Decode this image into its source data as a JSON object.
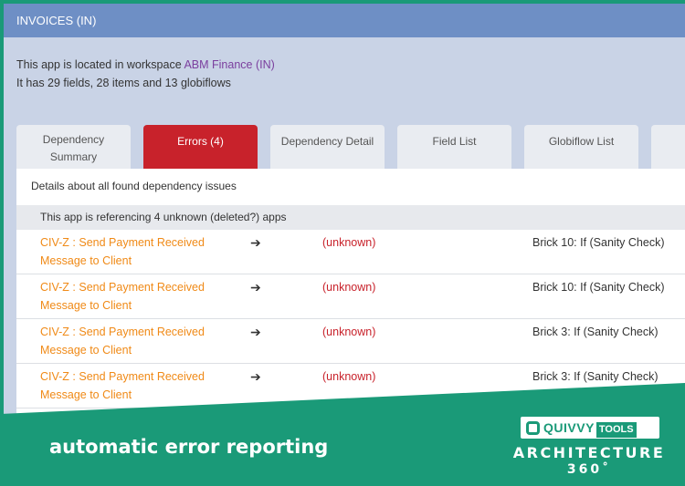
{
  "window": {
    "title": "INVOICES (IN)"
  },
  "info": {
    "location_prefix": "This app is located in workspace ",
    "workspace": "ABM Finance (IN)",
    "summary": "It has 29 fields, 28 items and 13 globiflows"
  },
  "tabs": [
    {
      "label": "Dependency\nSummary"
    },
    {
      "label": "Errors (4)"
    },
    {
      "label": "Dependency Detail"
    },
    {
      "label": "Field List"
    },
    {
      "label": "Globiflow List"
    }
  ],
  "content": {
    "description": "Details about all found dependency issues",
    "group_header": "This app is referencing 4 unknown (deleted?) apps",
    "rows": [
      {
        "source": "CIV-Z : Send Payment Received Message to Client",
        "arrow": "➔",
        "target": "(unknown)",
        "brick": "Brick 10: If (Sanity Check)"
      },
      {
        "source": "CIV-Z : Send Payment Received Message to Client",
        "arrow": "➔",
        "target": "(unknown)",
        "brick": "Brick 10: If (Sanity Check)"
      },
      {
        "source": "CIV-Z : Send Payment Received Message to Client",
        "arrow": "➔",
        "target": "(unknown)",
        "brick": "Brick 3: If (Sanity Check)"
      },
      {
        "source": "CIV-Z : Send Payment Received Message to Client",
        "arrow": "➔",
        "target": "(unknown)",
        "brick": "Brick 3: If (Sanity Check)"
      }
    ]
  },
  "banner": {
    "tagline": "automatic error reporting",
    "logo_name": "QUIVVY",
    "logo_tools": "TOOLS",
    "logo_line1": "ARCHITECTURE",
    "logo_line2": "360˚"
  },
  "colors": {
    "banner_green": "#1a9a78",
    "titlebar_blue": "#6e8fc5",
    "active_tab_red": "#c8222b",
    "link_orange": "#f08a17",
    "workspace_purple": "#7b3f9e"
  }
}
